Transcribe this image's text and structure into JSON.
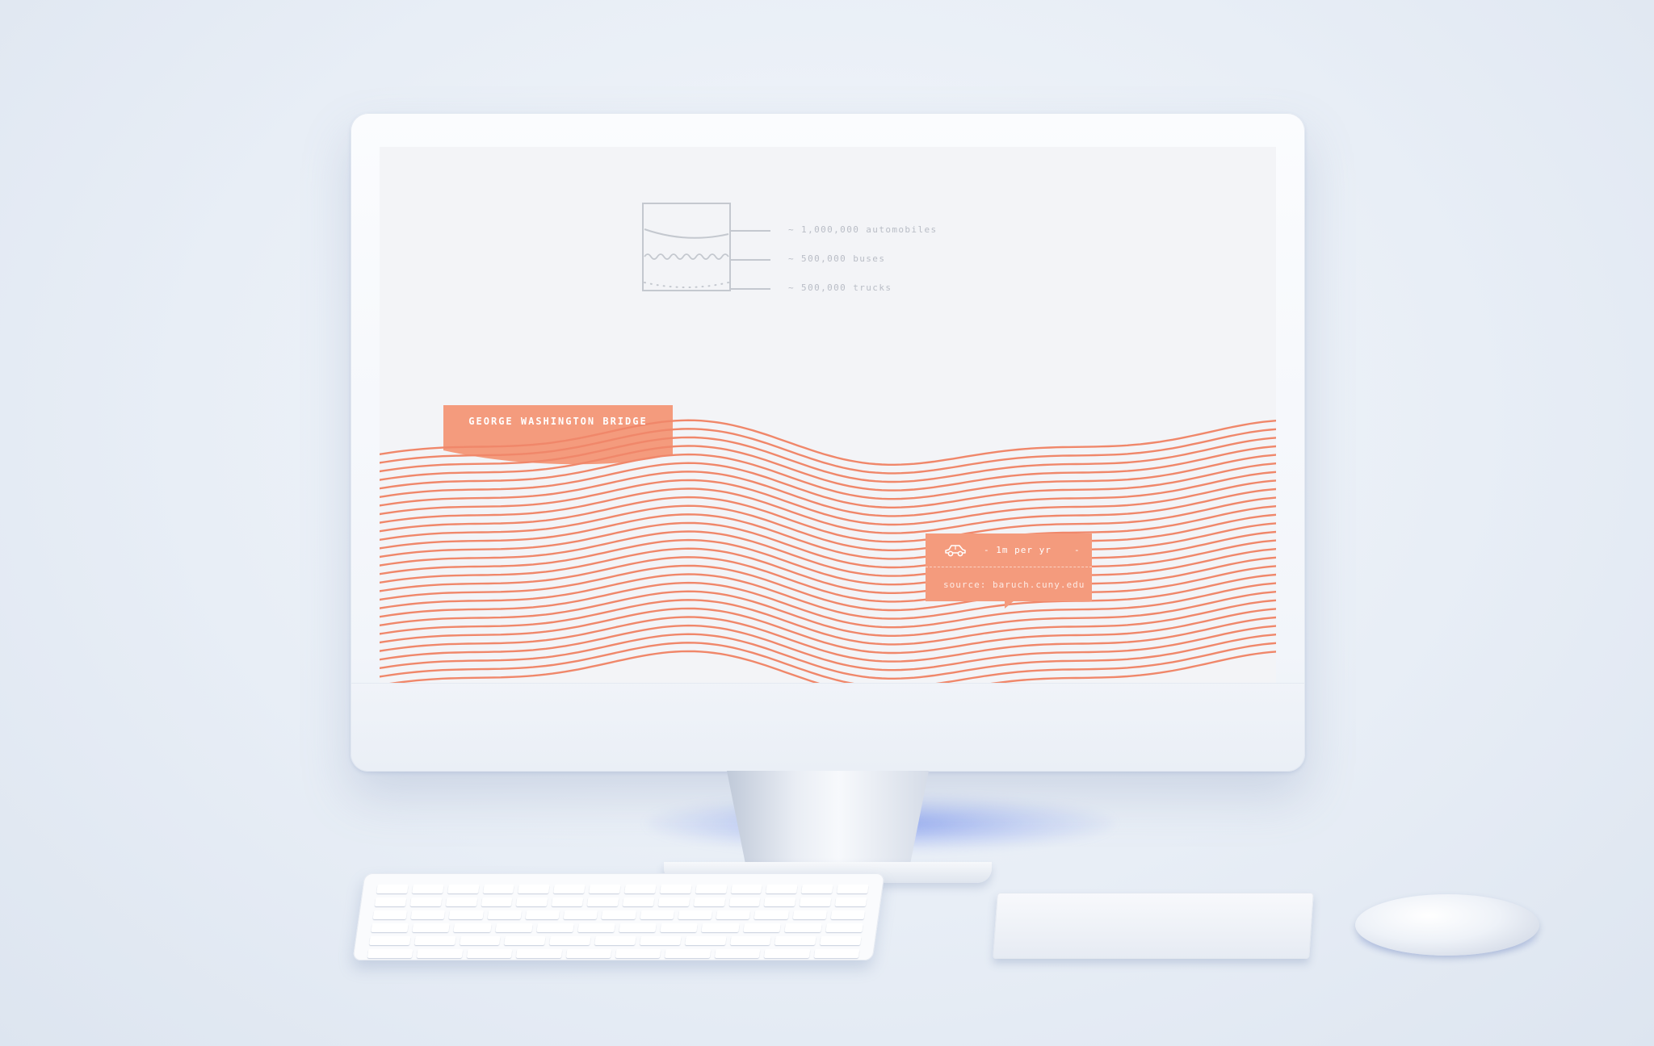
{
  "infographic": {
    "legend": [
      {
        "label": "~ 1,000,000 automobiles",
        "line_style": "solid"
      },
      {
        "label": "~ 500,000 buses",
        "line_style": "wavy"
      },
      {
        "label": "~ 500,000 trucks",
        "line_style": "dotted"
      }
    ],
    "bridge_title": "GEORGE WASHINGTON BRIDGE",
    "card": {
      "icon": "car-icon",
      "rate": "- 1m per yr",
      "dash": "-",
      "source": "source: baruch.cuny.edu"
    }
  },
  "colors": {
    "accent": "#f49b7d",
    "wave_line": "#f0876a",
    "legend_gray": "#c4c8cf",
    "screen_bg": "#f3f4f7"
  },
  "icons": [
    "car-icon"
  ]
}
